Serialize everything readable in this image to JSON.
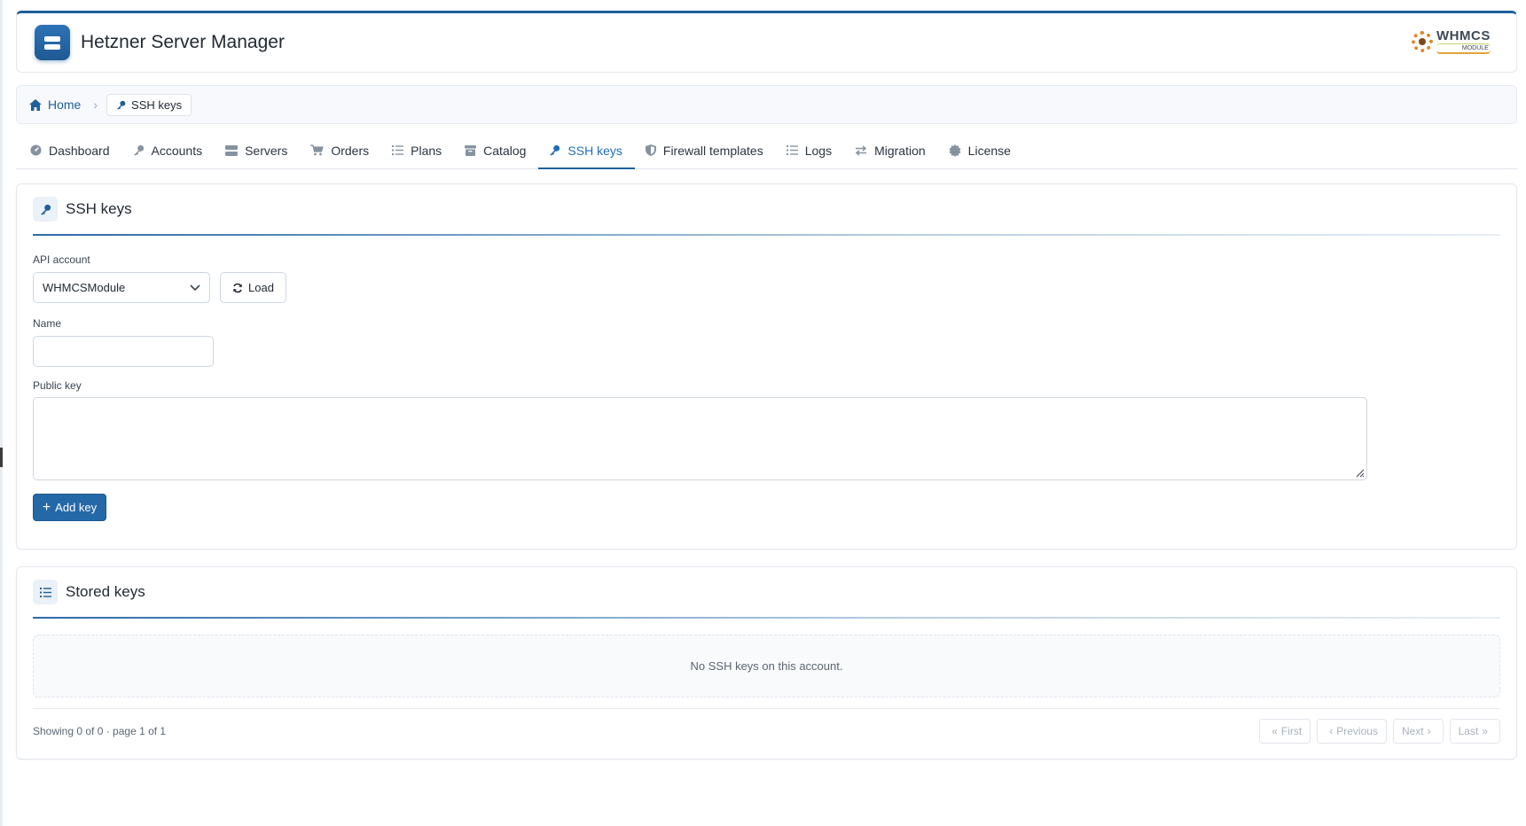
{
  "app": {
    "title": "Hetzner Server Manager",
    "logo_text_main": "WHMCS",
    "logo_text_sub": "MODULE"
  },
  "breadcrumb": {
    "home": "Home",
    "current": "SSH keys"
  },
  "tabs": [
    {
      "label": "Dashboard",
      "icon": "dashboard-icon"
    },
    {
      "label": "Accounts",
      "icon": "key-icon"
    },
    {
      "label": "Servers",
      "icon": "server-icon"
    },
    {
      "label": "Orders",
      "icon": "cart-icon"
    },
    {
      "label": "Plans",
      "icon": "list-icon"
    },
    {
      "label": "Catalog",
      "icon": "catalog-icon"
    },
    {
      "label": "SSH keys",
      "icon": "key-icon",
      "active": true
    },
    {
      "label": "Firewall templates",
      "icon": "shield-icon"
    },
    {
      "label": "Logs",
      "icon": "list-icon"
    },
    {
      "label": "Migration",
      "icon": "arrows-icon"
    },
    {
      "label": "License",
      "icon": "badge-icon"
    }
  ],
  "ssh_card": {
    "title": "SSH keys",
    "api_account_label": "API account",
    "api_account_value": "WHMCSModule",
    "load_label": "Load",
    "name_label": "Name",
    "name_value": "",
    "public_key_label": "Public key",
    "public_key_value": "",
    "add_label": "Add key"
  },
  "stored_card": {
    "title": "Stored keys",
    "empty_text": "No SSH keys on this account.",
    "showing_text": "Showing 0 of 0 · page 1 of 1",
    "pager": {
      "first": "First",
      "previous": "Previous",
      "next": "Next",
      "last": "Last"
    }
  },
  "colors": {
    "primary": "#1f5f9a",
    "accent": "#2468a8",
    "active_tab": "#1f6fb6"
  }
}
